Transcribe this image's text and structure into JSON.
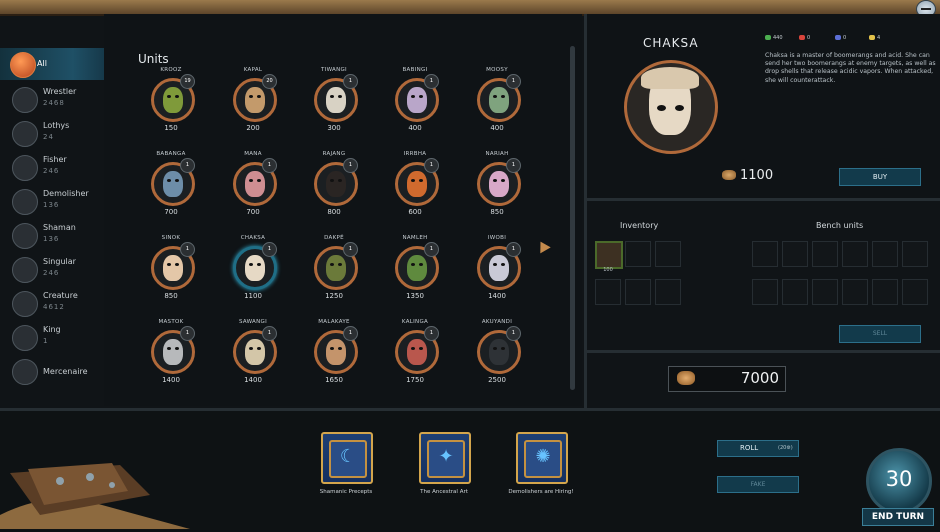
{
  "sidebar": {
    "items": [
      {
        "name": "All",
        "count": "",
        "icon": "orange-orb-icon"
      },
      {
        "name": "Wrestler",
        "count": "2468",
        "icon": "wrestler-icon"
      },
      {
        "name": "Lothys",
        "count": "24",
        "icon": "lothys-icon"
      },
      {
        "name": "Fisher",
        "count": "246",
        "icon": "fisher-icon"
      },
      {
        "name": "Demolisher",
        "count": "136",
        "icon": "demolisher-icon"
      },
      {
        "name": "Shaman",
        "count": "136",
        "icon": "shaman-icon"
      },
      {
        "name": "Singular",
        "count": "246",
        "icon": "singular-icon"
      },
      {
        "name": "Creature",
        "count": "4612",
        "icon": "creature-icon"
      },
      {
        "name": "King",
        "count": "1",
        "icon": "crown-icon"
      },
      {
        "name": "Mercenaire",
        "count": "",
        "icon": "mercenary-icon"
      }
    ]
  },
  "units_title": "Units",
  "units": [
    {
      "name": "KROOZ",
      "badge": "19",
      "price": "150",
      "color": "#7f9a3a"
    },
    {
      "name": "KAPAL",
      "badge": "20",
      "price": "200",
      "color": "#c39a6b"
    },
    {
      "name": "TIWANGI",
      "badge": "1",
      "price": "300",
      "color": "#d8d2c4"
    },
    {
      "name": "BABINGI",
      "badge": "1",
      "price": "400",
      "color": "#b9a6c9"
    },
    {
      "name": "MOOSY",
      "badge": "1",
      "price": "400",
      "color": "#7fa37e"
    },
    {
      "name": "BABANGA",
      "badge": "1",
      "price": "700",
      "color": "#6d8da8"
    },
    {
      "name": "MANA",
      "badge": "1",
      "price": "700",
      "color": "#cf8e92"
    },
    {
      "name": "RAJANG",
      "badge": "1",
      "price": "800",
      "color": "#2a2523"
    },
    {
      "name": "IRRBHA",
      "badge": "1",
      "price": "600",
      "color": "#d06a2e"
    },
    {
      "name": "NARIAH",
      "badge": "1",
      "price": "850",
      "color": "#d8a8c8"
    },
    {
      "name": "SINOK",
      "badge": "1",
      "price": "850",
      "color": "#e4c7a8"
    },
    {
      "name": "CHAKSA",
      "badge": "1",
      "price": "1100",
      "color": "#e6d9c5"
    },
    {
      "name": "DAKPÉ",
      "badge": "1",
      "price": "1250",
      "color": "#6b7a3a"
    },
    {
      "name": "NAMLEH",
      "badge": "1",
      "price": "1350",
      "color": "#5f8a3e"
    },
    {
      "name": "IWOBI",
      "badge": "1",
      "price": "1400",
      "color": "#c9c9d6"
    },
    {
      "name": "MASTOK",
      "badge": "1",
      "price": "1400",
      "color": "#b7b9bb"
    },
    {
      "name": "SAWANGI",
      "badge": "1",
      "price": "1400",
      "color": "#d3c6a8"
    },
    {
      "name": "MALAKAYE",
      "badge": "1",
      "price": "1650",
      "color": "#c4946b"
    },
    {
      "name": "KALINGA",
      "badge": "1",
      "price": "1750",
      "color": "#b9574d"
    },
    {
      "name": "AKUYANDI",
      "badge": "1",
      "price": "2500",
      "color": "#2e3236"
    }
  ],
  "detail": {
    "name": "CHAKSA",
    "stats": [
      {
        "value": "440",
        "color": "#4caf50"
      },
      {
        "value": "0",
        "color": "#d9443b"
      },
      {
        "value": "0",
        "color": "#5c6fd6"
      },
      {
        "value": "4",
        "color": "#e3c24a"
      }
    ],
    "description": "Chaksa is a master of boomerangs and acid. She can send her two boomerangs at enemy targets, as well as drop shells that release acidic vapors. When attacked, she will counterattack.",
    "price": "1100",
    "buy_label": "BUY"
  },
  "inventory": {
    "title": "Inventory",
    "item_count": "100",
    "bench_title": "Bench units",
    "sell_label": "SELL"
  },
  "gold": "7000",
  "books": [
    {
      "label": "Shamanic Precepts",
      "glyph": "☾"
    },
    {
      "label": "The Ancestral Art",
      "glyph": "✦"
    },
    {
      "label": "Demolishers are Hiring!",
      "glyph": "✺"
    }
  ],
  "controls": {
    "roll_label": "ROLL",
    "roll_cost": "(20⚙)",
    "fake_label": "FAKE",
    "timer": "30",
    "end_turn": "END TURN"
  }
}
